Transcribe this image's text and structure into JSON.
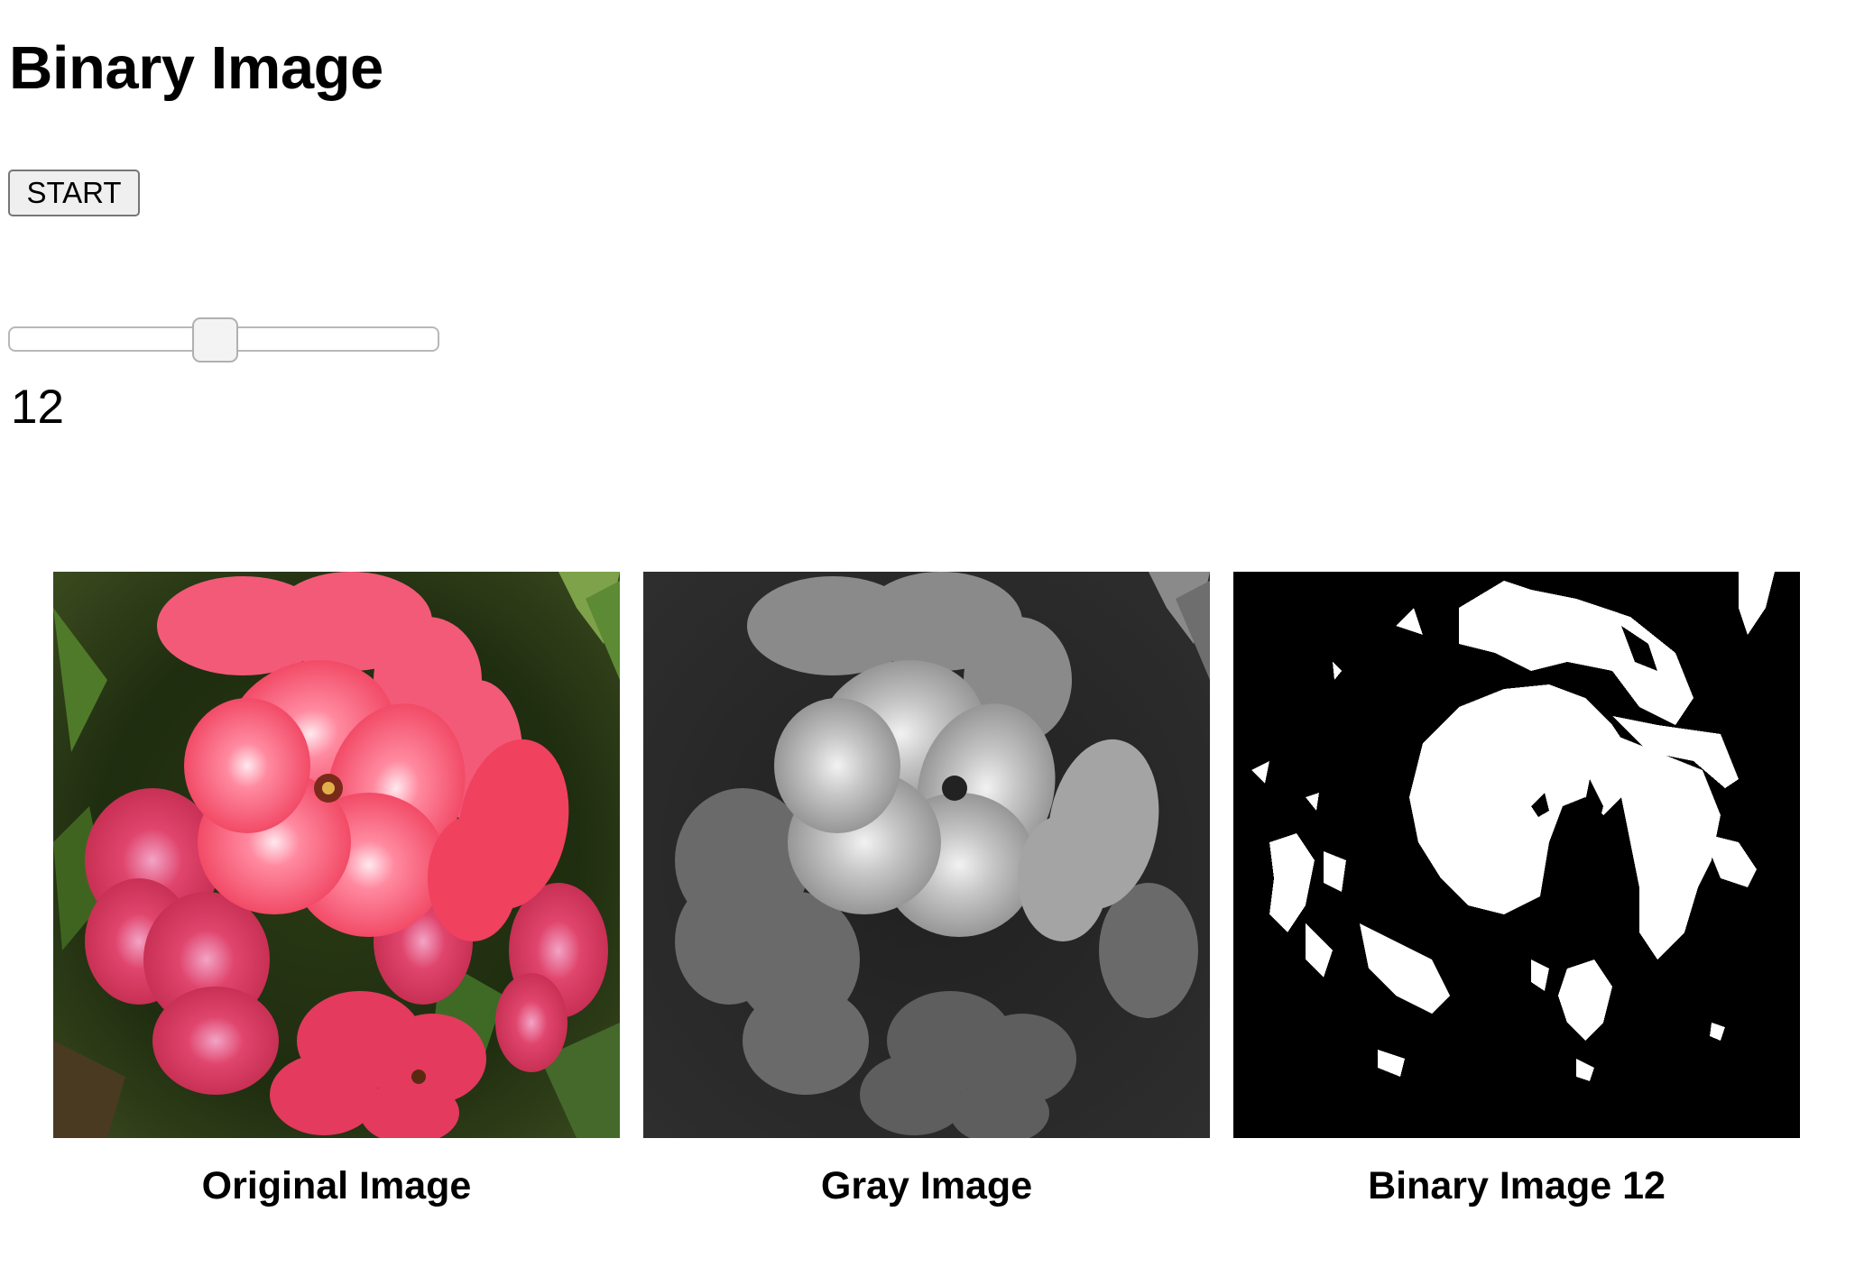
{
  "page": {
    "title": "Binary Image"
  },
  "controls": {
    "start_label": "START",
    "threshold_value": "12",
    "threshold_fraction": 0.48
  },
  "images": [
    {
      "caption": "Original Image",
      "icon": "flower-photo-color"
    },
    {
      "caption": "Gray Image",
      "icon": "flower-photo-grayscale"
    },
    {
      "caption": "Binary Image 12",
      "icon": "flower-photo-binary"
    }
  ],
  "colors": {
    "petal": "#f0415e",
    "binary_foreground": "#ffffff",
    "binary_background": "#000000"
  }
}
